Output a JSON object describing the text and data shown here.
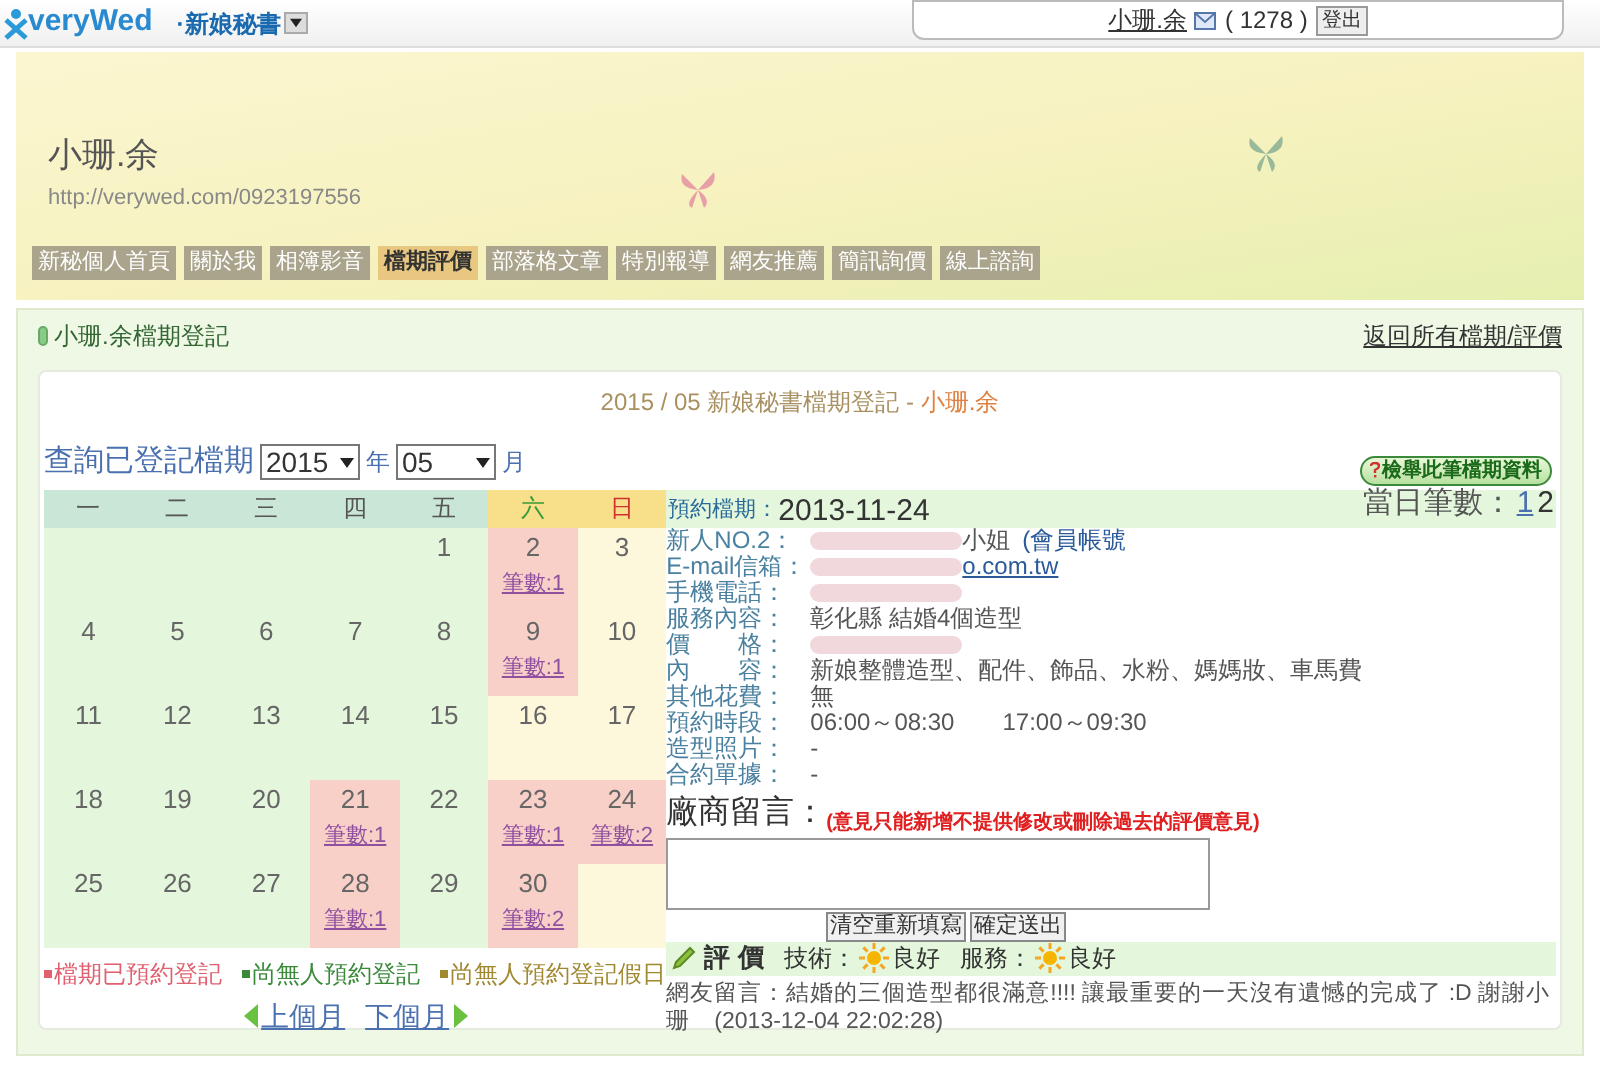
{
  "topbar": {
    "logo": "veryWed",
    "section": "·新娘秘書",
    "user": "小珊.余",
    "count": "( 1278 )",
    "logout": "登出"
  },
  "banner": {
    "name": "小珊.余",
    "url": "http://verywed.com/0923197556"
  },
  "nav": [
    {
      "label": "新秘個人首頁",
      "selected": false
    },
    {
      "label": "關於我",
      "selected": false
    },
    {
      "label": "相簿影音",
      "selected": false
    },
    {
      "label": "檔期評價",
      "selected": true
    },
    {
      "label": "部落格文章",
      "selected": false
    },
    {
      "label": "特別報導",
      "selected": false
    },
    {
      "label": "網友推薦",
      "selected": false
    },
    {
      "label": "簡訊詢價",
      "selected": false
    },
    {
      "label": "線上諮詢",
      "selected": false
    }
  ],
  "section": {
    "title": "小珊.余檔期登記",
    "back_link": "返回所有檔期/評價"
  },
  "heading": {
    "prefix": "2015 / 05 新娘秘書檔期登記 - ",
    "name": "小珊.余"
  },
  "query": {
    "label": "查詢已登記檔期",
    "year": "2015",
    "year_unit": "年",
    "month": "05",
    "month_unit": "月"
  },
  "report_button": "檢舉此筆檔期資料",
  "calendar": {
    "weekdays": [
      {
        "label": "一",
        "kind": "weekday"
      },
      {
        "label": "二",
        "kind": "weekday"
      },
      {
        "label": "三",
        "kind": "weekday"
      },
      {
        "label": "四",
        "kind": "weekday"
      },
      {
        "label": "五",
        "kind": "weekday"
      },
      {
        "label": "六",
        "kind": "saturday"
      },
      {
        "label": "日",
        "kind": "sunday"
      }
    ],
    "weeks": [
      [
        {
          "kind": "blank"
        },
        {
          "kind": "blank"
        },
        {
          "kind": "blank"
        },
        {
          "kind": "blank"
        },
        {
          "day": "1",
          "kind": "free"
        },
        {
          "day": "2",
          "kind": "booked",
          "count": "筆數:1"
        },
        {
          "day": "3",
          "kind": "holiday"
        }
      ],
      [
        {
          "day": "4",
          "kind": "free"
        },
        {
          "day": "5",
          "kind": "free"
        },
        {
          "day": "6",
          "kind": "free"
        },
        {
          "day": "7",
          "kind": "free"
        },
        {
          "day": "8",
          "kind": "free"
        },
        {
          "day": "9",
          "kind": "booked",
          "count": "筆數:1"
        },
        {
          "day": "10",
          "kind": "holiday"
        }
      ],
      [
        {
          "day": "11",
          "kind": "free"
        },
        {
          "day": "12",
          "kind": "free"
        },
        {
          "day": "13",
          "kind": "free"
        },
        {
          "day": "14",
          "kind": "free"
        },
        {
          "day": "15",
          "kind": "free"
        },
        {
          "day": "16",
          "kind": "holiday"
        },
        {
          "day": "17",
          "kind": "holiday"
        }
      ],
      [
        {
          "day": "18",
          "kind": "free"
        },
        {
          "day": "19",
          "kind": "free"
        },
        {
          "day": "20",
          "kind": "free"
        },
        {
          "day": "21",
          "kind": "booked",
          "count": "筆數:1"
        },
        {
          "day": "22",
          "kind": "free"
        },
        {
          "day": "23",
          "kind": "booked",
          "count": "筆數:1"
        },
        {
          "day": "24",
          "kind": "booked",
          "count": "筆數:2"
        }
      ],
      [
        {
          "day": "25",
          "kind": "free"
        },
        {
          "day": "26",
          "kind": "free"
        },
        {
          "day": "27",
          "kind": "free"
        },
        {
          "day": "28",
          "kind": "booked",
          "count": "筆數:1"
        },
        {
          "day": "29",
          "kind": "free"
        },
        {
          "day": "30",
          "kind": "booked",
          "count": "筆數:2"
        },
        {
          "kind": "holiday"
        }
      ]
    ],
    "legend": [
      {
        "label": "檔期已預約登記",
        "color": "#e06070"
      },
      {
        "label": "尚無人預約登記",
        "color": "#3a8a3a"
      },
      {
        "label": "尚無人預約登記假日",
        "color": "#a08830"
      }
    ],
    "prev": "上個月",
    "next": "下個月"
  },
  "detail": {
    "date_label": "預約檔期：",
    "date": "2013-11-24",
    "day_count_label": "當日筆數：",
    "day_pages": [
      {
        "label": "1",
        "selected": false
      },
      {
        "label": "2",
        "selected": true
      }
    ],
    "fields": [
      {
        "label": "新人NO.2：",
        "value": "小姐",
        "account": "(會員帳號",
        "redacted": true
      },
      {
        "label": "E-mail信箱：",
        "value": "o.com.tw",
        "kind": "link",
        "redacted": true
      },
      {
        "label": "手機電話：",
        "redacted": true
      },
      {
        "label": "服務內容：",
        "value": "彰化縣 結婚4個造型"
      },
      {
        "label": "價　　格：",
        "redacted": true
      },
      {
        "label": "內　　容：",
        "value": "新娘整體造型、配件、飾品、水粉、媽媽妝、車馬費"
      },
      {
        "label": "其他花費：",
        "value": "無"
      },
      {
        "label": "預約時段：",
        "value": "06:00～08:30　　17:00～09:30"
      },
      {
        "label": "造型照片：",
        "value": "-"
      },
      {
        "label": "合約單據：",
        "value": "-"
      }
    ],
    "vendor_label": "廠商留言：",
    "vendor_note": "(意見只能新增不提供修改或刪除過去的評價意見)",
    "clear": "清空重新填寫",
    "submit": "確定送出",
    "rating_title": "評 價",
    "ratings": [
      {
        "label": "技術：",
        "value": "良好"
      },
      {
        "label": "服務：",
        "value": "良好"
      }
    ],
    "comment": "網友留言：結婚的三個造型都很滿意!!!! 讓最重要的一天沒有遺憾的完成了 :D 謝謝小珊　(2013-12-04 22:02:28)"
  }
}
